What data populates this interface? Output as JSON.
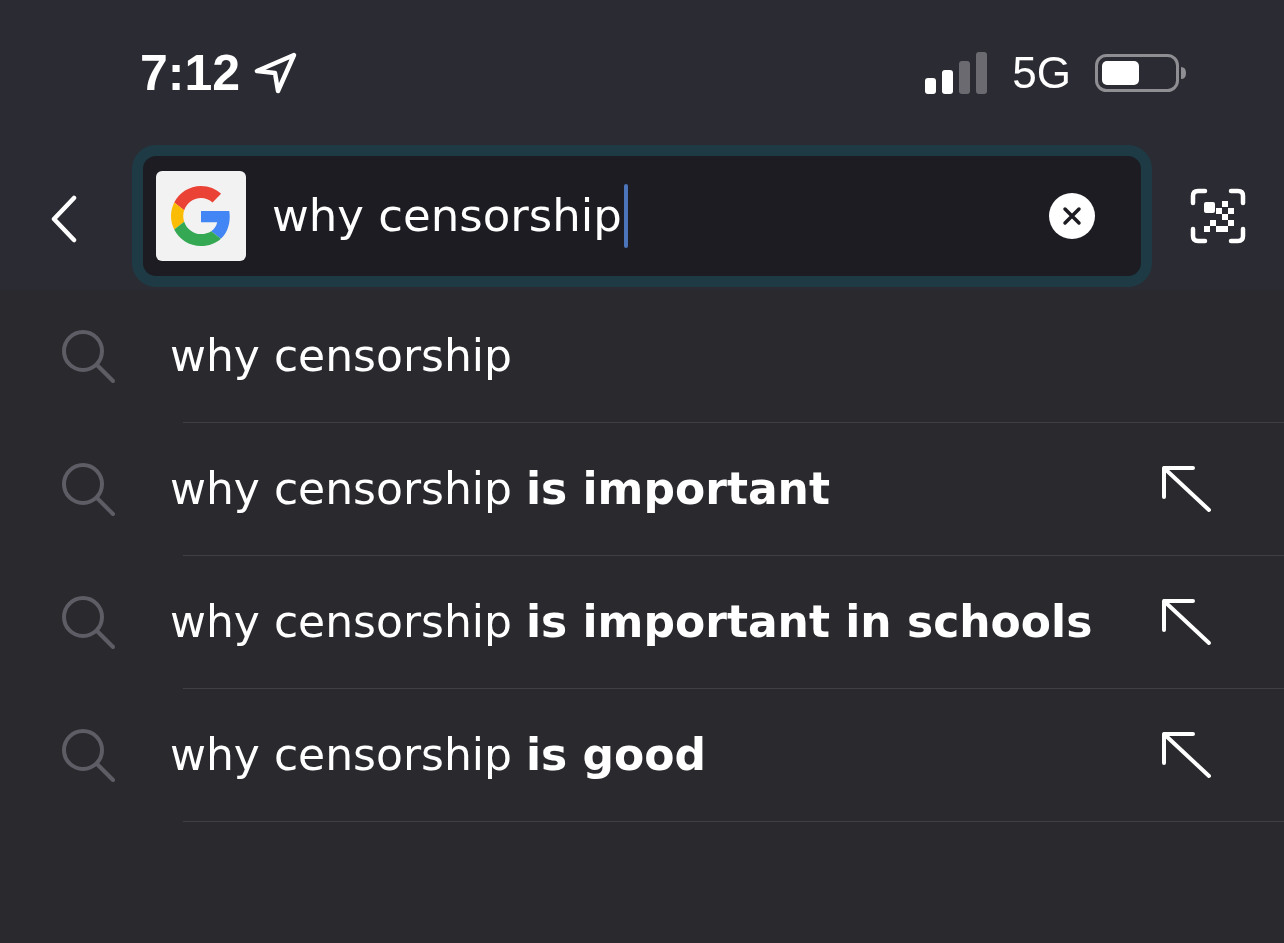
{
  "status_bar": {
    "time": "7:12",
    "network": "5G"
  },
  "search_bar": {
    "value": "why censorship",
    "focused": true
  },
  "suggestions": [
    {
      "text": "why censorship",
      "kind": "query"
    },
    {
      "text": "why censorship **is important**",
      "kind": "completion"
    },
    {
      "text": "why censorship **is important in schools**",
      "kind": "completion"
    },
    {
      "text": "why censorship **is good**",
      "kind": "completion"
    }
  ]
}
